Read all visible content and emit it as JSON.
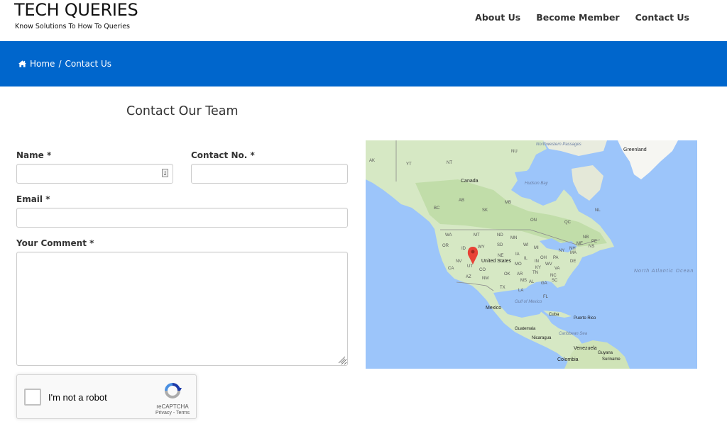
{
  "header": {
    "brand_title": "TECH QUERIES",
    "brand_tagline": "Know Solutions To How To Queries",
    "nav": [
      {
        "label": "About Us"
      },
      {
        "label": "Become Member"
      },
      {
        "label": "Contact Us"
      }
    ]
  },
  "banner": {
    "breadcrumb": {
      "home_label": "Home",
      "separator": "/",
      "current": "Contact Us"
    },
    "color": "#0066cc"
  },
  "main": {
    "title": "Contact Our Team",
    "form": {
      "name_label": "Name *",
      "name_value": "",
      "contact_label": "Contact No. *",
      "contact_value": "",
      "email_label": "Email *",
      "email_value": "",
      "comment_label": "Your Comment *",
      "comment_value": ""
    },
    "recaptcha": {
      "label": "I'm not a robot",
      "brand": "reCAPTCHA",
      "privacy": "Privacy",
      "link_separator": " - ",
      "terms": "Terms",
      "checked": false
    }
  },
  "map": {
    "countries": [
      {
        "name": "Canada"
      },
      {
        "name": "Greenland"
      },
      {
        "name": "United States"
      },
      {
        "name": "Mexico"
      },
      {
        "name": "Cuba"
      },
      {
        "name": "Puerto Rico"
      },
      {
        "name": "Guatemala"
      },
      {
        "name": "Nicaragua"
      },
      {
        "name": "Venezuela"
      },
      {
        "name": "Colombia"
      },
      {
        "name": "Guyana"
      },
      {
        "name": "Suriname"
      }
    ],
    "regions": [
      "AK",
      "YT",
      "NT",
      "NU",
      "BC",
      "AB",
      "SK",
      "MB",
      "ON",
      "QC",
      "NL",
      "NB",
      "PE",
      "NS",
      "WA",
      "MT",
      "ND",
      "MN",
      "OR",
      "ID",
      "WY",
      "SD",
      "WI",
      "MI",
      "NY",
      "NH",
      "MA",
      "ME",
      "NV",
      "UT",
      "NE",
      "IA",
      "IL",
      "IN",
      "OH",
      "PA",
      "CA",
      "CO",
      "MO",
      "KY",
      "WV",
      "VA",
      "DE",
      "AZ",
      "NM",
      "OK",
      "AR",
      "TN",
      "NC",
      "MS",
      "AL",
      "GA",
      "SC",
      "TX",
      "LA",
      "FL"
    ],
    "water": {
      "northwestern_passages": "Northwestern Passages",
      "hudson_bay": "Hudson Bay",
      "gulf_of_mexico": "Gulf of Mexico",
      "caribbean_sea": "Caribbean Sea",
      "north_atlantic_ocean": "North Atlantic Ocean"
    },
    "marker": {
      "location": "Utah",
      "color": "#e84236"
    },
    "colors": {
      "water": "#9cc5fa",
      "land": "#d6e8c4",
      "forest": "#b5d69a",
      "ice": "#f4f4f0"
    }
  }
}
